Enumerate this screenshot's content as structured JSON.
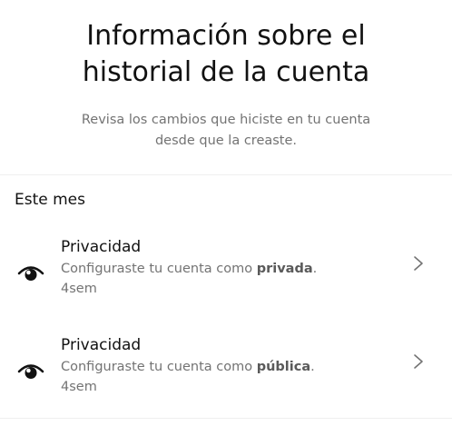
{
  "header": {
    "title_line1": "Información sobre el",
    "title_line2": "historial de la cuenta",
    "subtitle_line1": "Revisa los cambios que hiciste en tu cuenta",
    "subtitle_line2": "desde que la creaste."
  },
  "section": {
    "heading": "Este mes"
  },
  "events": [
    {
      "icon": "eye-icon",
      "heading": "Privacidad",
      "desc_prefix": "Configuraste tu cuenta como ",
      "desc_emphasis": "privada",
      "desc_suffix": ".",
      "time": "4sem"
    },
    {
      "icon": "eye-icon",
      "heading": "Privacidad",
      "desc_prefix": "Configuraste tu cuenta como ",
      "desc_emphasis": "pública",
      "desc_suffix": ".",
      "time": "4sem"
    }
  ],
  "colors": {
    "primary_text": "#111111",
    "secondary_text": "#737373",
    "divider": "#efefef"
  }
}
